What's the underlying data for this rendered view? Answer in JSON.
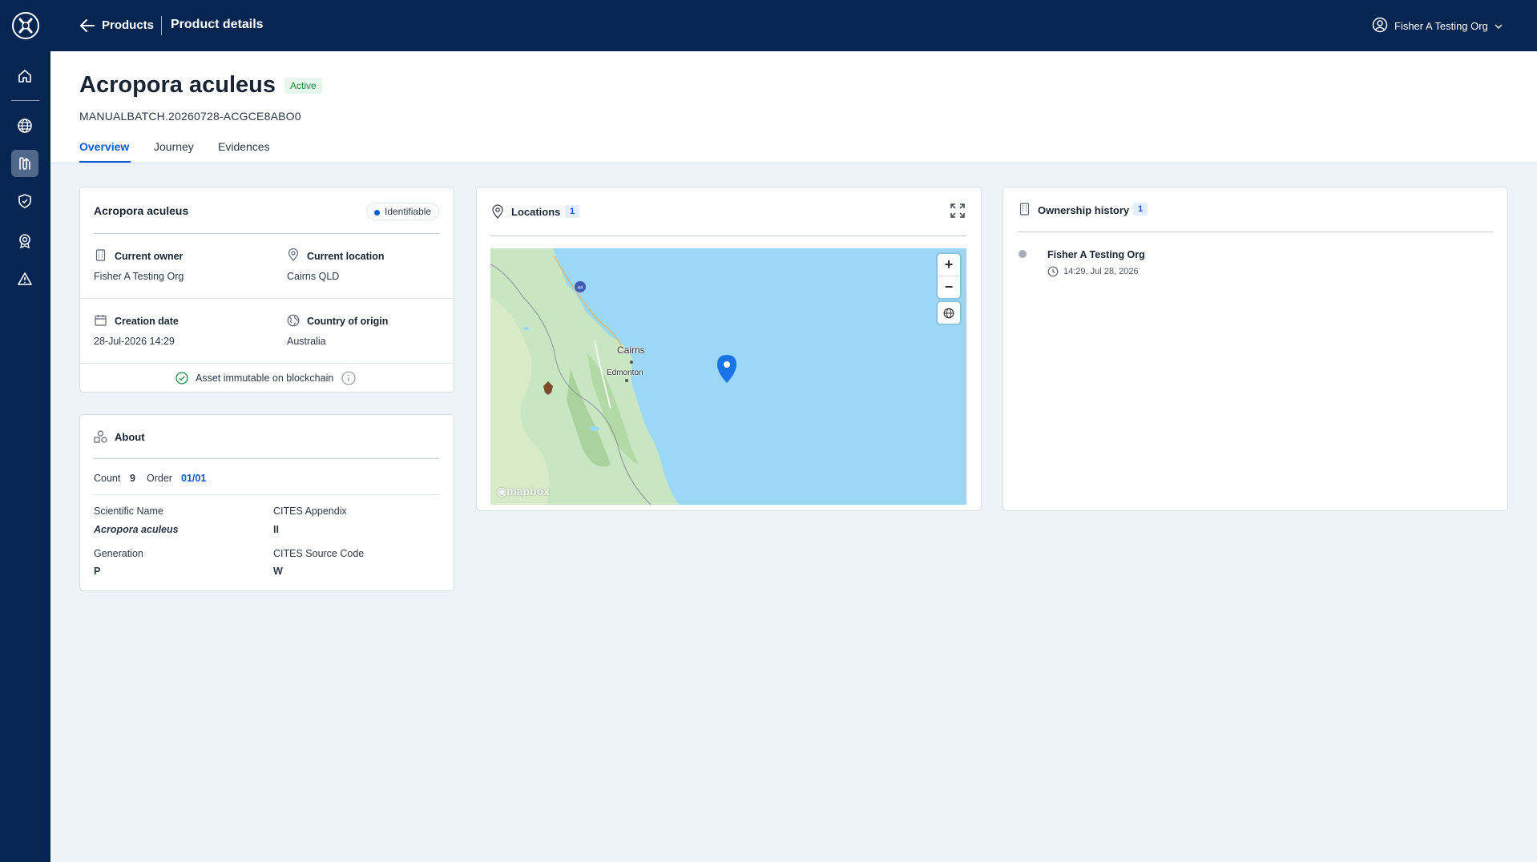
{
  "topbar": {
    "back_label": "Products",
    "page_title": "Product details",
    "user_name": "Fisher A Testing Org"
  },
  "sidebar": {
    "items": [
      {
        "icon": "home-icon"
      },
      {
        "icon": "globe-icon"
      },
      {
        "icon": "journey-icon"
      },
      {
        "icon": "shield-icon"
      },
      {
        "icon": "badge-icon"
      },
      {
        "icon": "warning-icon"
      }
    ],
    "active": "journey-icon"
  },
  "header": {
    "title": "Acropora aculeus",
    "status": "Active",
    "batch_id": "MANUALBATCH.20260728-ACGCE8ABO0",
    "tabs": [
      {
        "label": "Overview",
        "active": true
      },
      {
        "label": "Journey",
        "active": false
      },
      {
        "label": "Evidences",
        "active": false
      }
    ]
  },
  "summary_card": {
    "title": "Acropora aculeus",
    "pill": "Identifiable",
    "current_owner_label": "Current owner",
    "current_owner_value": "Fisher A Testing Org",
    "current_location_label": "Current location",
    "current_location_value": "Cairns QLD",
    "creation_date_label": "Creation date",
    "creation_date_value": "28-Jul-2026 14:29",
    "country_label": "Country of origin",
    "country_value": "Australia",
    "blockchain_text": "Asset immutable on blockchain"
  },
  "about_card": {
    "title": "About",
    "count_label": "Count",
    "count_value": "9",
    "order_label": "Order",
    "order_value": "01/01",
    "fields": [
      {
        "label": "Scientific Name",
        "value": "Acropora aculeus"
      },
      {
        "label": "CITES Appendix",
        "value": "II"
      },
      {
        "label": "Generation",
        "value": "P"
      },
      {
        "label": "CITES Source Code",
        "value": "W"
      }
    ]
  },
  "locations_card": {
    "title": "Locations",
    "count": "1",
    "map_labels": [
      "Cairns",
      "Edmonton"
    ],
    "attribution": "mapbox"
  },
  "ownership_card": {
    "title": "Ownership history",
    "count": "1",
    "entries": [
      {
        "owner": "Fisher A Testing Org",
        "time": "14:29, Jul 28, 2026"
      }
    ]
  },
  "colors": {
    "navy": "#062550",
    "accent": "#0b5bd3",
    "active_green": "#21893e",
    "background": "#eef2f9"
  }
}
